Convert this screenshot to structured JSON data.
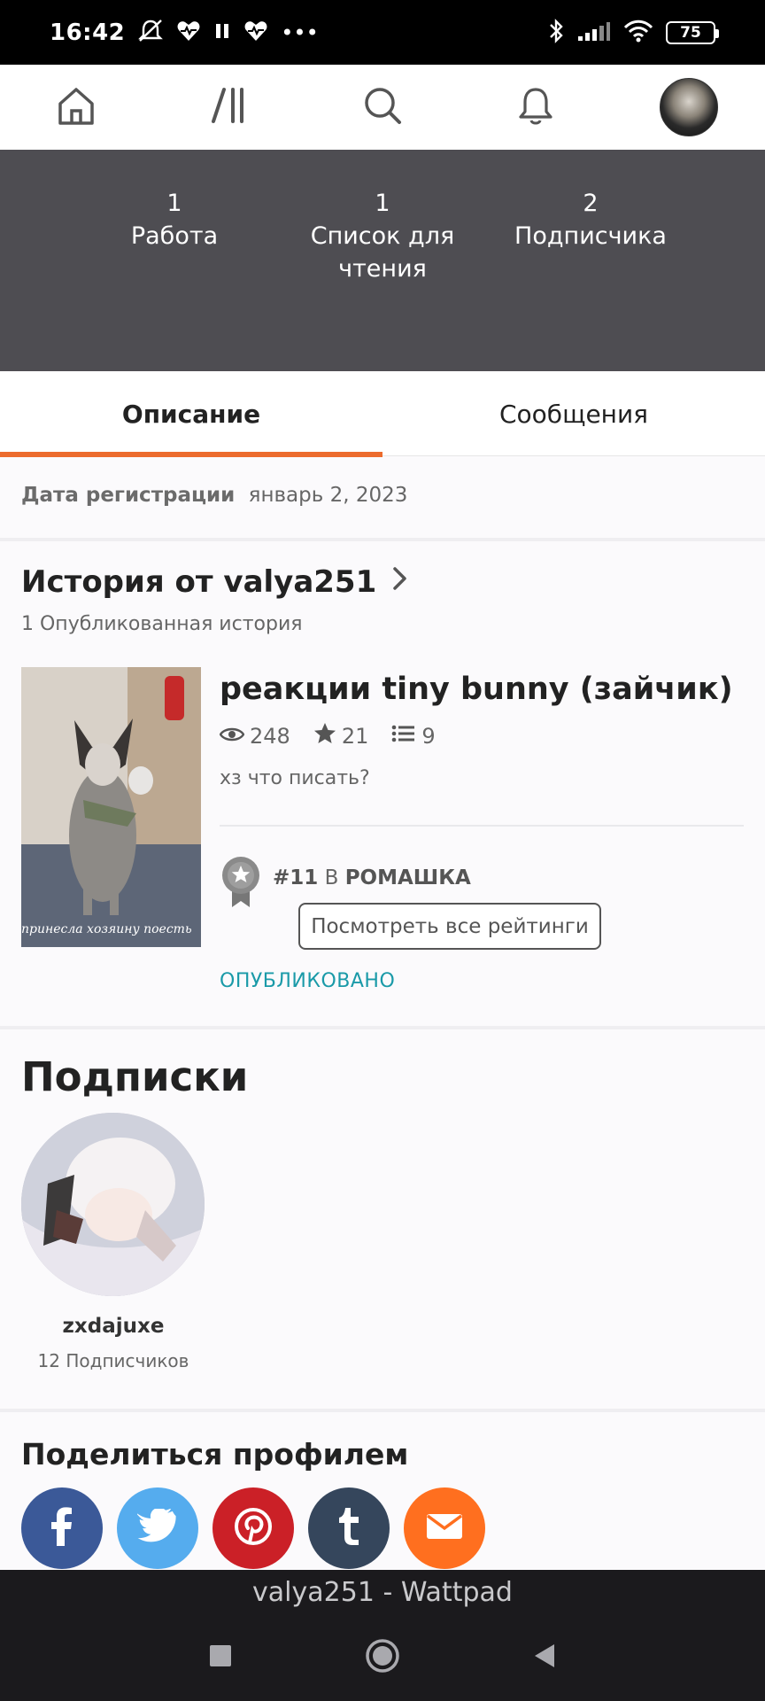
{
  "status_bar": {
    "time": "16:42",
    "battery": "75",
    "more": "•••"
  },
  "nav": {
    "items": [
      "home-icon",
      "library-icon",
      "search-icon",
      "notifications-icon",
      "profile-avatar"
    ]
  },
  "stats": [
    {
      "value": "1",
      "label": "Работа"
    },
    {
      "value": "1",
      "label": "Список для чтения"
    },
    {
      "value": "2",
      "label": "Подписчика"
    }
  ],
  "tabs": {
    "about": "Описание",
    "messages": "Сообщения"
  },
  "about": {
    "registration_label": "Дата регистрации",
    "registration_date": "январь 2, 2023"
  },
  "stories": {
    "title": "История от valya251",
    "subtitle": "1 Опубликованная история",
    "story": {
      "title": "реакции tiny bunny (зайчик)",
      "reads": "248",
      "votes": "21",
      "parts": "9",
      "description": "хз что писать?",
      "cover_caption": "принесла хозяину поесть",
      "rank_number": "#11",
      "rank_in": "В",
      "rank_tag": "РОМАШКА",
      "ratings_button": "Посмотреть все рейтинги",
      "status": "ОПУБЛИКОВАНО"
    }
  },
  "following": {
    "title": "Подписки",
    "user": {
      "name": "zxdajuxe",
      "followers": "12 Подписчиков"
    }
  },
  "share": {
    "title": "Поделиться профилем",
    "buttons": [
      {
        "name": "facebook",
        "color": "#3b5998"
      },
      {
        "name": "twitter",
        "color": "#55acee"
      },
      {
        "name": "pinterest",
        "color": "#cb2027"
      },
      {
        "name": "tumblr",
        "color": "#35465c"
      },
      {
        "name": "email",
        "color": "#ff6f1f"
      }
    ]
  },
  "page_title": "valya251 - Wattpad",
  "colors": {
    "accent": "#ec6b2d",
    "published": "#1a9aa8",
    "header_band": "#4e4d52"
  }
}
